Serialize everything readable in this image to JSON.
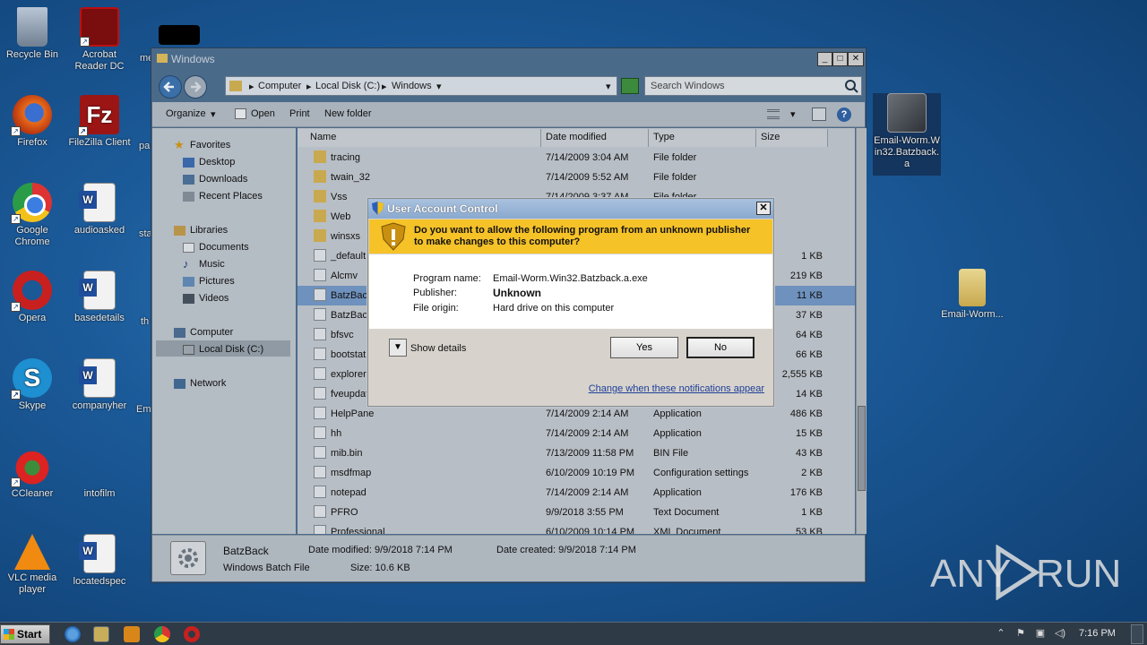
{
  "desktop": {
    "icons": [
      {
        "label": "Recycle Bin",
        "icon": "recycle-bin-icon"
      },
      {
        "label": "Acrobat Reader DC",
        "icon": "acrobat-icon"
      },
      {
        "label": "Firefox",
        "icon": "firefox-icon"
      },
      {
        "label": "FileZilla Client",
        "icon": "filezilla-icon"
      },
      {
        "label": "Google Chrome",
        "icon": "chrome-icon"
      },
      {
        "label": "audioasked",
        "icon": "word-document-icon"
      },
      {
        "label": "Opera",
        "icon": "opera-icon"
      },
      {
        "label": "basedetails",
        "icon": "word-document-icon"
      },
      {
        "label": "Skype",
        "icon": "skype-icon"
      },
      {
        "label": "companyher",
        "icon": "word-document-icon"
      },
      {
        "label": "CCleaner",
        "icon": "ccleaner-icon"
      },
      {
        "label": "intofilm",
        "icon": "blank-file-icon"
      },
      {
        "label": "VLC media player",
        "icon": "vlc-icon"
      },
      {
        "label": "locatedspec",
        "icon": "word-document-icon"
      },
      {
        "label": "Email-Worm.Win32.Batzback.a",
        "icon": "wolf-image-icon"
      },
      {
        "label": "Email-Worm...",
        "icon": "folder-icon"
      }
    ],
    "partial_labels": [
      "me",
      "pa",
      "sta",
      "th",
      "Em"
    ]
  },
  "explorer": {
    "title": "Windows",
    "minimize": "_",
    "maximize": "□",
    "close": "✕",
    "address": [
      "Computer",
      "Local Disk (C:)",
      "Windows"
    ],
    "search_placeholder": "Search Windows",
    "commands": {
      "organize": "Organize",
      "open": "Open",
      "print": "Print",
      "new_folder": "New folder"
    },
    "nav": {
      "favorites": "Favorites",
      "desktop": "Desktop",
      "downloads": "Downloads",
      "recent": "Recent Places",
      "libraries": "Libraries",
      "documents": "Documents",
      "music": "Music",
      "pictures": "Pictures",
      "videos": "Videos",
      "computer": "Computer",
      "local_disk": "Local Disk (C:)",
      "network": "Network"
    },
    "columns": {
      "name": "Name",
      "date": "Date modified",
      "type": "Type",
      "size": "Size"
    },
    "rows": [
      {
        "name": "tracing",
        "date": "7/14/2009 3:04 AM",
        "type": "File folder",
        "size": ""
      },
      {
        "name": "twain_32",
        "date": "7/14/2009 5:52 AM",
        "type": "File folder",
        "size": ""
      },
      {
        "name": "Vss",
        "date": "7/14/2009 3:37 AM",
        "type": "File folder",
        "size": ""
      },
      {
        "name": "Web",
        "date": "",
        "type": "",
        "size": ""
      },
      {
        "name": "winsxs",
        "date": "",
        "type": "",
        "size": ""
      },
      {
        "name": "_default",
        "date": "",
        "type": "",
        "size": "1 KB"
      },
      {
        "name": "Alcmv",
        "date": "",
        "type": "",
        "size": "219 KB"
      },
      {
        "name": "BatzBack",
        "date": "",
        "type": "",
        "size": "11 KB"
      },
      {
        "name": "BatzBack",
        "date": "",
        "type": "",
        "size": "37 KB"
      },
      {
        "name": "bfsvc",
        "date": "",
        "type": "",
        "size": "64 KB"
      },
      {
        "name": "bootstat",
        "date": "",
        "type": "",
        "size": "66 KB"
      },
      {
        "name": "explorer",
        "date": "",
        "type": "",
        "size": "2,555 KB"
      },
      {
        "name": "fveupdate",
        "date": "",
        "type": "",
        "size": "14 KB"
      },
      {
        "name": "HelpPane",
        "date": "7/14/2009 2:14 AM",
        "type": "Application",
        "size": "486 KB"
      },
      {
        "name": "hh",
        "date": "7/14/2009 2:14 AM",
        "type": "Application",
        "size": "15 KB"
      },
      {
        "name": "mib.bin",
        "date": "7/13/2009 11:58 PM",
        "type": "BIN File",
        "size": "43 KB"
      },
      {
        "name": "msdfmap",
        "date": "6/10/2009 10:19 PM",
        "type": "Configuration settings",
        "size": "2 KB"
      },
      {
        "name": "notepad",
        "date": "7/14/2009 2:14 AM",
        "type": "Application",
        "size": "176 KB"
      },
      {
        "name": "PFRO",
        "date": "9/9/2018 3:55 PM",
        "type": "Text Document",
        "size": "1 KB"
      },
      {
        "name": "Professional",
        "date": "6/10/2009 10:14 PM",
        "type": "XML Document",
        "size": "53 KB"
      }
    ],
    "details": {
      "name": "BatzBack",
      "type": "Windows Batch File",
      "modified": "Date modified: 9/9/2018 7:14 PM",
      "size": "Size: 10.6 KB",
      "created": "Date created: 9/9/2018 7:14 PM"
    }
  },
  "uac": {
    "title": "User Account Control",
    "close": "✕",
    "question": "Do you want to allow the following program from an unknown publisher to make changes to this computer?",
    "program_label": "Program name:",
    "program_value": "Email-Worm.Win32.Batzback.a.exe",
    "publisher_label": "Publisher:",
    "publisher_value": "Unknown",
    "origin_label": "File origin:",
    "origin_value": "Hard drive on this computer",
    "show_details": "Show details",
    "yes": "Yes",
    "no": "No",
    "link": "Change when these notifications appear"
  },
  "taskbar": {
    "start": "Start",
    "clock": "7:16 PM"
  },
  "watermark": {
    "left": "ANY",
    "right": "RUN"
  }
}
